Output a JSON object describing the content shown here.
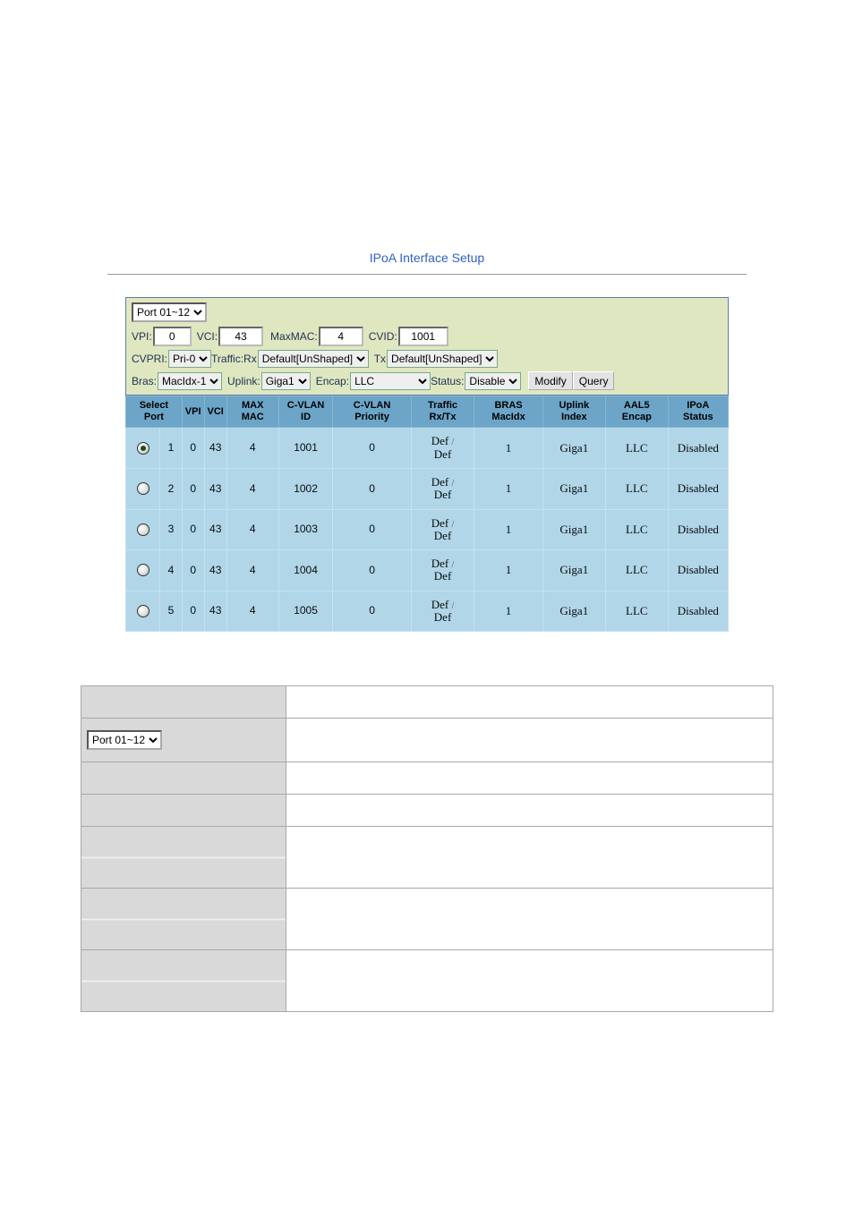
{
  "title": "IPoA Interface Setup",
  "port_select": {
    "selected": "Port 01~12"
  },
  "form": {
    "vpi": {
      "label": "VPI:",
      "value": "0"
    },
    "vci": {
      "label": "VCI:",
      "value": "43"
    },
    "maxmac": {
      "label": "MaxMAC:",
      "value": "4"
    },
    "cvid": {
      "label": "CVID:",
      "value": "1001"
    },
    "cvpri": {
      "label": "CVPRI:",
      "value": "Pri-0"
    },
    "traffic_rx": {
      "label": "Traffic:Rx",
      "value": "Default[UnShaped]"
    },
    "tx": {
      "label": "Tx",
      "value": "Default[UnShaped]"
    },
    "bras": {
      "label": "Bras:",
      "value": "MacIdx-1"
    },
    "uplink": {
      "label": "Uplink:",
      "value": "Giga1"
    },
    "encap": {
      "label": "Encap:",
      "value": "LLC"
    },
    "status": {
      "label": "Status:",
      "value": "Disable"
    },
    "modify_label": "Modify",
    "query_label": "Query"
  },
  "table": {
    "headers": {
      "select": "Select",
      "port": "Port",
      "vpi": "VPI",
      "vci": "VCI",
      "maxmac": "MAX MAC",
      "cvlan_id": "C-VLAN ID",
      "cvlan_pri": "C-VLAN Priority",
      "traffic": "Traffic Rx/Tx",
      "bras": "BRAS MacIdx",
      "uplink": "Uplink Index",
      "aal5": "AAL5 Encap",
      "ipoa": "IPoA Status"
    },
    "rows": [
      {
        "selected": true,
        "port": "1",
        "vpi": "0",
        "vci": "43",
        "maxmac": "4",
        "cvid": "1001",
        "cvpri": "0",
        "traffic_rx": "Def",
        "traffic_tx": "Def",
        "bras": "1",
        "uplink": "Giga1",
        "aal5": "LLC",
        "status": "Disabled"
      },
      {
        "selected": false,
        "port": "2",
        "vpi": "0",
        "vci": "43",
        "maxmac": "4",
        "cvid": "1002",
        "cvpri": "0",
        "traffic_rx": "Def",
        "traffic_tx": "Def",
        "bras": "1",
        "uplink": "Giga1",
        "aal5": "LLC",
        "status": "Disabled"
      },
      {
        "selected": false,
        "port": "3",
        "vpi": "0",
        "vci": "43",
        "maxmac": "4",
        "cvid": "1003",
        "cvpri": "0",
        "traffic_rx": "Def",
        "traffic_tx": "Def",
        "bras": "1",
        "uplink": "Giga1",
        "aal5": "LLC",
        "status": "Disabled"
      },
      {
        "selected": false,
        "port": "4",
        "vpi": "0",
        "vci": "43",
        "maxmac": "4",
        "cvid": "1004",
        "cvpri": "0",
        "traffic_rx": "Def",
        "traffic_tx": "Def",
        "bras": "1",
        "uplink": "Giga1",
        "aal5": "LLC",
        "status": "Disabled"
      },
      {
        "selected": false,
        "port": "5",
        "vpi": "0",
        "vci": "43",
        "maxmac": "4",
        "cvid": "1005",
        "cvpri": "0",
        "traffic_rx": "Def",
        "traffic_tx": "Def",
        "bras": "1",
        "uplink": "Giga1",
        "aal5": "LLC",
        "status": "Disabled"
      }
    ]
  },
  "layout_port_select": "Port 01~12"
}
